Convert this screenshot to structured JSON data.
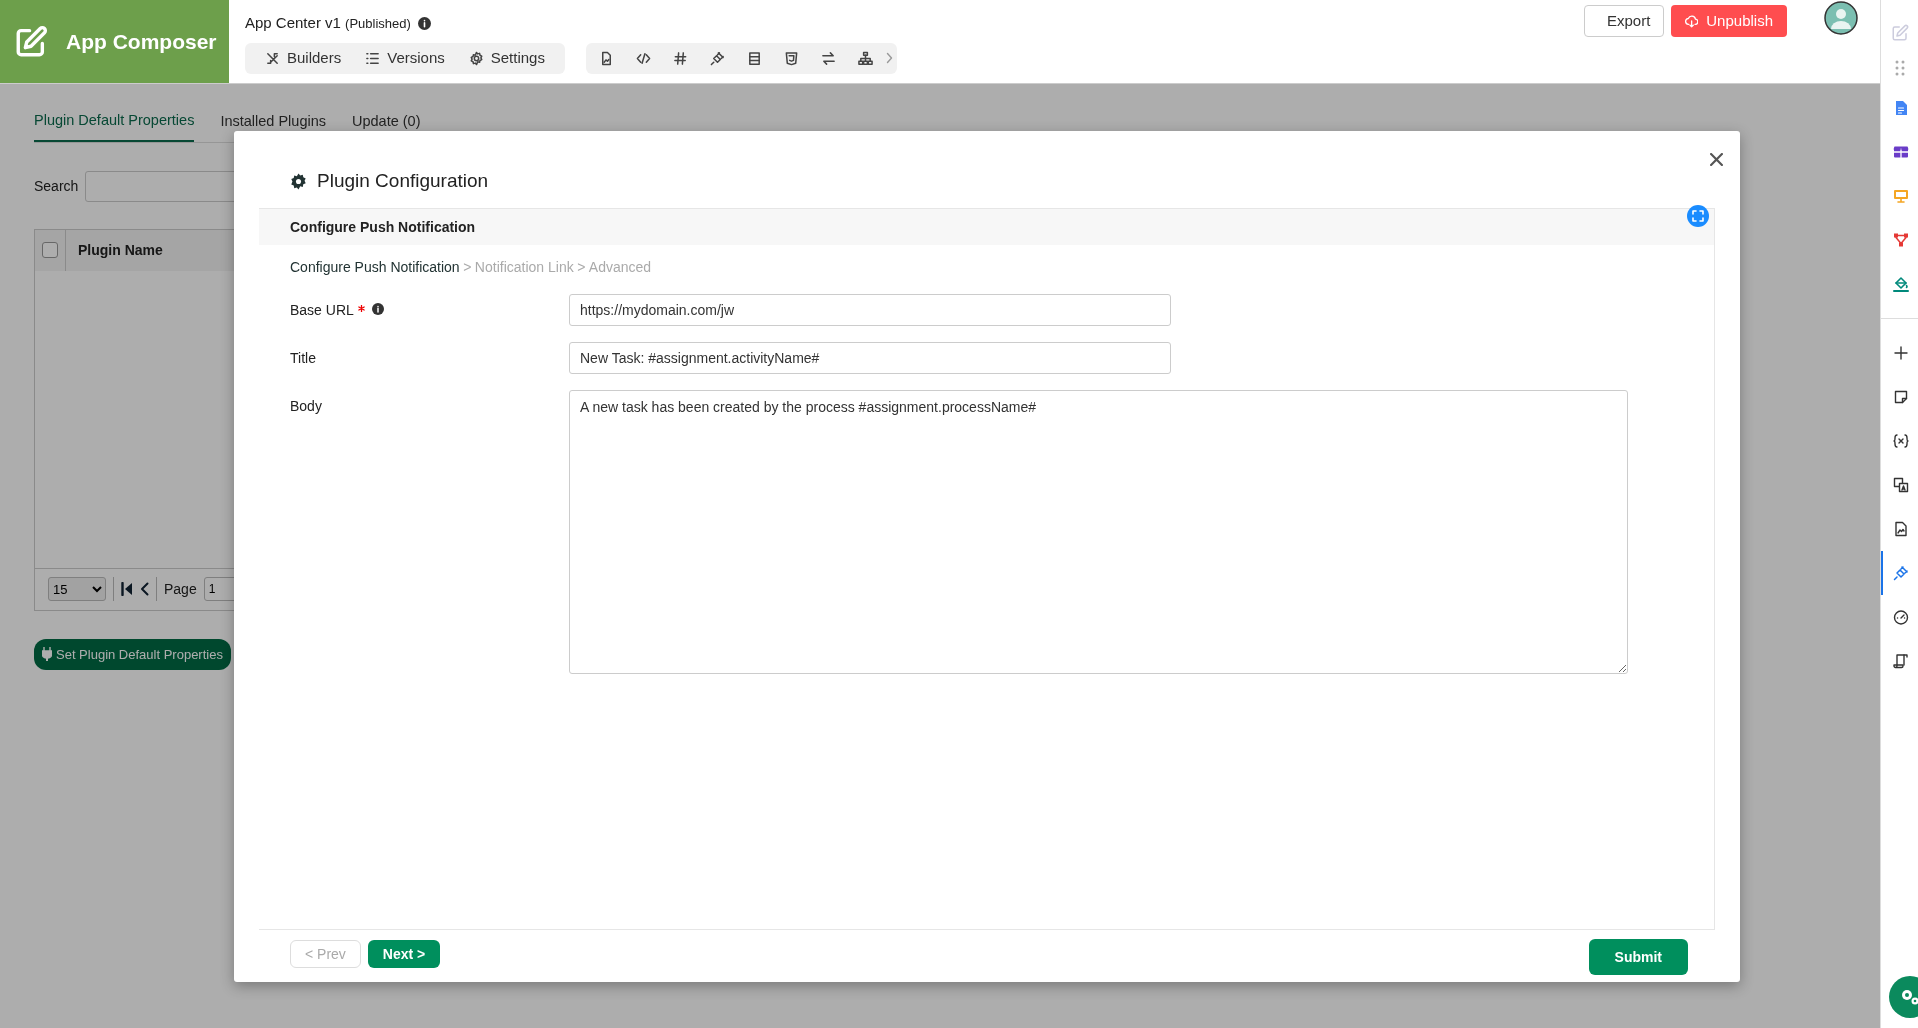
{
  "header": {
    "logo_title": "App Composer",
    "app_title": "App Center v1",
    "app_status": "(Published)",
    "nav": [
      {
        "label": "Builders",
        "kind": "builders"
      },
      {
        "label": "Versions",
        "kind": "versions"
      },
      {
        "label": "Settings",
        "kind": "settings"
      }
    ],
    "actions": [
      {
        "label": "Export",
        "kind": "export"
      },
      {
        "label": "Unpublish",
        "kind": "unpublish"
      }
    ]
  },
  "page": {
    "tabs": [
      {
        "label": "Plugin Default Properties",
        "selected": true
      },
      {
        "label": "Installed Plugins",
        "selected": false
      },
      {
        "label": "Update (0)",
        "selected": false
      }
    ],
    "search_label": "Search",
    "table": {
      "select_all_checked": false,
      "columns": [
        "Plugin Name"
      ]
    },
    "pager": {
      "page_size": "15",
      "page_label": "Page",
      "page_value": "1"
    },
    "set_button": "Set Plugin Default Properties"
  },
  "modal": {
    "title": "Plugin Configuration",
    "section": "Configure Push Notification",
    "breadcrumb": [
      {
        "label": "Configure Push Notification",
        "current": true
      },
      {
        "label": "Notification Link",
        "current": false
      },
      {
        "label": "Advanced",
        "current": false
      }
    ],
    "breadcrumb_separator": ">",
    "fields": [
      {
        "label": "Base URL",
        "required": true,
        "info": true,
        "kind": "input",
        "value": "https://mydomain.com/jw"
      },
      {
        "label": "Title",
        "required": false,
        "info": false,
        "kind": "input",
        "value": "New Task: #assignment.activityName#"
      },
      {
        "label": "Body",
        "required": false,
        "info": false,
        "kind": "textarea",
        "value": "A new task has been created by the process #assignment.processName#"
      }
    ],
    "buttons": [
      {
        "label": "< Prev",
        "kind": "prev",
        "disabled": true
      },
      {
        "label": "Next >",
        "kind": "next",
        "disabled": false
      },
      {
        "label": "Submit",
        "kind": "submit",
        "disabled": false
      }
    ]
  },
  "sidebar": {
    "items": [
      {
        "kind": "document",
        "selected": false
      },
      {
        "kind": "datalist",
        "selected": false
      },
      {
        "kind": "userview",
        "selected": false
      },
      {
        "kind": "process",
        "selected": false
      },
      {
        "kind": "theme",
        "selected": false
      },
      {
        "kind": "divider"
      },
      {
        "kind": "add",
        "selected": false
      },
      {
        "kind": "note",
        "selected": false
      },
      {
        "kind": "variables",
        "selected": false
      },
      {
        "kind": "translate",
        "selected": false
      },
      {
        "kind": "resources",
        "selected": false
      },
      {
        "kind": "plugin",
        "selected": true
      },
      {
        "kind": "performance",
        "selected": false
      },
      {
        "kind": "logs",
        "selected": false
      }
    ]
  }
}
